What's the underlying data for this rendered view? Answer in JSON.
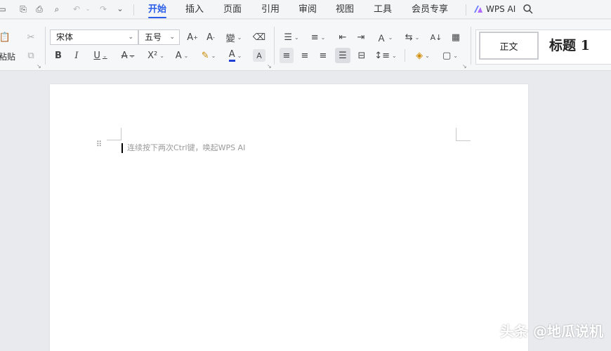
{
  "menubar": {
    "tabs": [
      "开始",
      "插入",
      "页面",
      "引用",
      "审阅",
      "视图",
      "工具",
      "会员专享"
    ],
    "active_tab": "开始",
    "ai_label": "WPS AI",
    "accent_color": "#2a5ee8"
  },
  "ribbon": {
    "paste_label": "粘贴",
    "font_name": "宋体",
    "font_size": "五号",
    "styles": {
      "normal": "正文",
      "heading1": "标题 1"
    }
  },
  "document": {
    "hint_text": "连续按下两次Ctrl键，唤起WPS AI"
  },
  "watermark": "头条 @地瓜说机"
}
